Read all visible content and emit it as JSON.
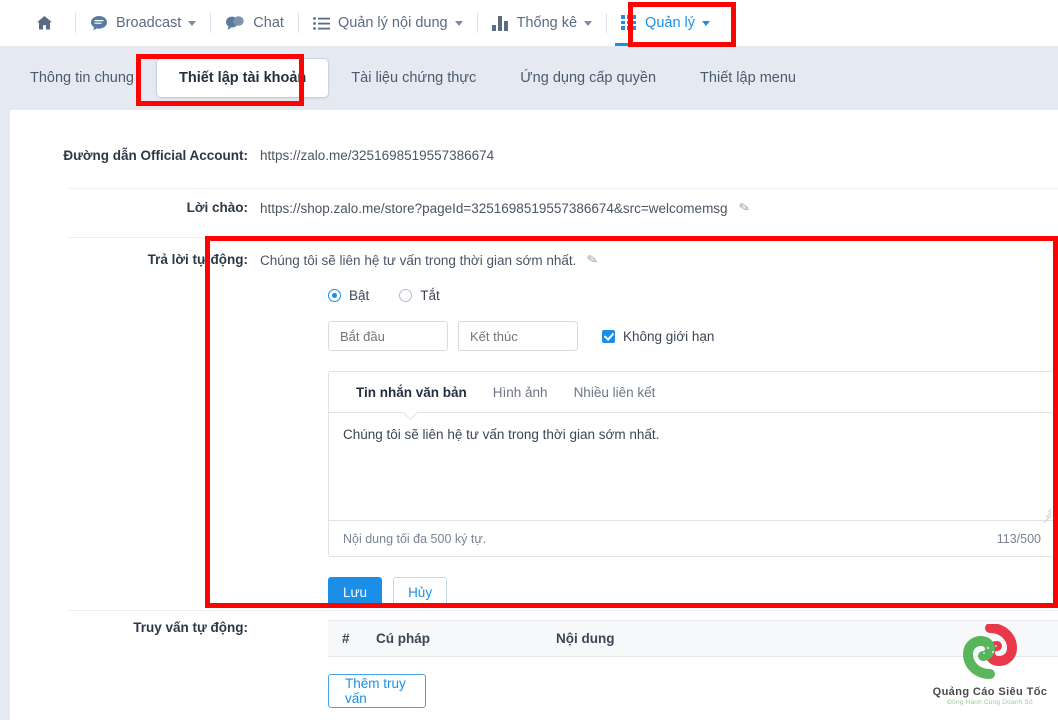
{
  "topnav": {
    "items": [
      {
        "label": "",
        "icon": "home-icon",
        "caret": false,
        "active": false
      },
      {
        "label": "Broadcast",
        "icon": "speech-bubble-icon",
        "caret": true,
        "active": false
      },
      {
        "label": "Chat",
        "icon": "chat-bubbles-icon",
        "caret": false,
        "active": false
      },
      {
        "label": "Quản lý nội dung",
        "icon": "list-icon",
        "caret": true,
        "active": false
      },
      {
        "label": "Thống kê",
        "icon": "bar-chart-icon",
        "caret": true,
        "active": false
      },
      {
        "label": "Quản lý",
        "icon": "grid-apps-icon",
        "caret": true,
        "active": true
      }
    ]
  },
  "subtabs": {
    "items": [
      {
        "label": "Thông tin chung",
        "selected": false
      },
      {
        "label": "Thiết lập tài khoản",
        "selected": true
      },
      {
        "label": "Tài liệu chứng thực",
        "selected": false
      },
      {
        "label": "Ứng dụng cấp quyền",
        "selected": false
      },
      {
        "label": "Thiết lập menu",
        "selected": false
      }
    ]
  },
  "form": {
    "oa_url": {
      "label": "Đường dẫn Official Account:",
      "value": "https://zalo.me/3251698519557386674"
    },
    "greeting": {
      "label": "Lời chào:",
      "value": "https://shop.zalo.me/store?pageId=3251698519557386674&src=welcomemsg",
      "edit_icon": "pencil-icon"
    },
    "auto_reply": {
      "label": "Trả lời tự động:",
      "value": "Chúng tôi sẽ liên hệ tư vấn trong thời gian sớm nhất.",
      "edit_icon": "pencil-icon",
      "radio_on_label": "Bật",
      "radio_off_label": "Tắt",
      "radio_selected": "Bật",
      "start_placeholder": "Bắt đầu",
      "start_value": "",
      "end_placeholder": "Kết thúc",
      "end_value": "",
      "unlimited_label": "Không giới hạn",
      "unlimited_checked": true,
      "tabs": [
        {
          "label": "Tin nhắn văn bản",
          "active": true
        },
        {
          "label": "Hình ảnh",
          "active": false
        },
        {
          "label": "Nhiều liên kết",
          "active": false
        }
      ],
      "message_text": "Chúng tôi sẽ liên hệ tư vấn trong thời gian sớm nhất.",
      "hint": "Nội dung tối đa 500 ký tự.",
      "counter": "113/500",
      "save_label": "Lưu",
      "cancel_label": "Hủy"
    },
    "auto_query": {
      "label": "Truy vấn tự động:",
      "columns": [
        "#",
        "Cú pháp",
        "Nội dung"
      ],
      "rows": [],
      "add_label": "Thêm truy vấn"
    }
  },
  "watermark": {
    "title": "Quảng Cáo Siêu Tốc",
    "subtitle": "Đồng Hành Cùng Doanh Số",
    "logo_icon": "spiral-logo-icon"
  },
  "colors": {
    "accent": "#1b8ee8",
    "highlight": "#fc0404",
    "page_bg": "#e4e9f2",
    "panel_bg": "#ffffff",
    "logo_red": "#e8283c",
    "logo_green": "#4bb04f"
  }
}
